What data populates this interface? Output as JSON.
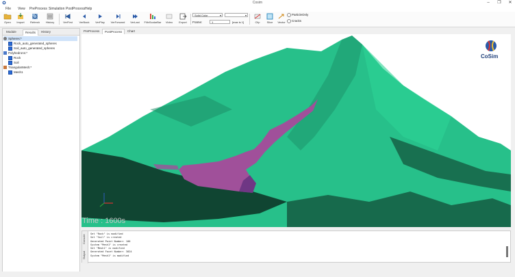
{
  "window": {
    "title": "Cosim"
  },
  "menu": [
    "File",
    "View",
    "PreProcess",
    "Simulation",
    "PostProcess",
    "Help"
  ],
  "toolbar": {
    "buttons": [
      "Open",
      "Import",
      "Refresh",
      "History",
      "VerFirst",
      "VerBack",
      "VerPlay",
      "VerForward",
      "VerLast",
      "FillnScalarBar",
      "Video",
      "Export",
      "Clip",
      "Slice",
      "Vector"
    ],
    "display_mode": "Solid Color",
    "field_select": "",
    "frame_label": "Frame:",
    "frame_value": "1",
    "frame_max": "[max is 1]",
    "opt_particle": "ParticleOnly",
    "opt_cracks": "Cracks"
  },
  "left_panel": {
    "tabs": [
      "Module",
      "Results",
      "History"
    ],
    "tree": [
      {
        "label": "Spheres:*",
        "level": 0
      },
      {
        "label": "Rock_auto_generated_spheres",
        "level": 1
      },
      {
        "label": "Soil_auto_generated_spheres",
        "level": 1
      },
      {
        "label": "Polyhedrons:*",
        "level": 0
      },
      {
        "label": "Rock",
        "level": 1
      },
      {
        "label": "Soil",
        "level": 1
      },
      {
        "label": "TriangularMesh:*",
        "level": 0
      },
      {
        "label": "Mesh1",
        "level": 1
      }
    ]
  },
  "view_tabs": [
    "PreProcess",
    "PostProcess",
    "Chart"
  ],
  "viewport": {
    "time_label": "Time : 1600s",
    "logo_text": "CoSim",
    "colors": {
      "terrain": "#27c08a",
      "debris": "#a0509a",
      "background": "#ffffff"
    }
  },
  "bottom_panel": {
    "tabs": [
      "Console",
      "Output"
    ],
    "lines": [
      "Set \"Rock\" is modified",
      "Set \"Soil\" is created",
      "Generated Point Number: 100",
      "System \"Mesh1\" is created",
      "Set \"Mesh1\" is modified",
      "Generated Facet Number: 3024",
      "System \"Mesh1\" is modified"
    ]
  }
}
